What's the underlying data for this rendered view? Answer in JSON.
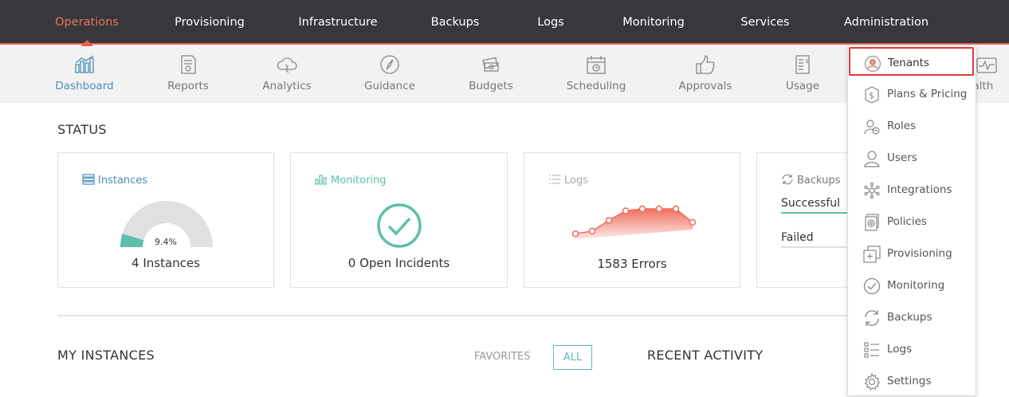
{
  "topnav": {
    "items": [
      {
        "label": "Operations",
        "active": true
      },
      {
        "label": "Provisioning"
      },
      {
        "label": "Infrastructure"
      },
      {
        "label": "Backups"
      },
      {
        "label": "Logs"
      },
      {
        "label": "Monitoring"
      },
      {
        "label": "Services"
      },
      {
        "label": "Administration"
      }
    ]
  },
  "subnav": {
    "items": [
      {
        "label": "Dashboard",
        "icon": "bar-chart-icon",
        "active": true
      },
      {
        "label": "Reports",
        "icon": "report-icon"
      },
      {
        "label": "Analytics",
        "icon": "cloud-analytics-icon"
      },
      {
        "label": "Guidance",
        "icon": "compass-icon"
      },
      {
        "label": "Budgets",
        "icon": "money-stack-icon"
      },
      {
        "label": "Scheduling",
        "icon": "calendar-clock-icon"
      },
      {
        "label": "Approvals",
        "icon": "thumbs-up-icon"
      },
      {
        "label": "Usage",
        "icon": "usage-icon"
      }
    ],
    "health_partial": "Health"
  },
  "status": {
    "title": "STATUS",
    "instances": {
      "title": "Instances",
      "gauge_label": "9.4%",
      "gauge_fraction": 0.094,
      "value": "4 Instances"
    },
    "monitoring": {
      "title": "Monitoring",
      "value": "0 Open Incidents"
    },
    "logs": {
      "title": "Logs",
      "value": "1583 Errors",
      "sparkline": [
        8,
        12,
        28,
        42,
        45,
        45,
        45,
        25
      ]
    },
    "backups": {
      "title": "Backups",
      "successful": "Successful",
      "failed": "Failed"
    }
  },
  "bottom": {
    "my_instances": "MY INSTANCES",
    "favorites": "FAVORITES",
    "all": "ALL",
    "recent_activity": "RECENT ACTIVITY"
  },
  "dropdown": {
    "items": [
      {
        "label": "Tenants",
        "icon": "tenant-icon",
        "selected": true
      },
      {
        "label": "Plans & Pricing",
        "icon": "dollar-icon"
      },
      {
        "label": "Roles",
        "icon": "roles-icon"
      },
      {
        "label": "Users",
        "icon": "user-icon"
      },
      {
        "label": "Integrations",
        "icon": "integrations-icon"
      },
      {
        "label": "Policies",
        "icon": "policies-icon"
      },
      {
        "label": "Provisioning",
        "icon": "provisioning-icon"
      },
      {
        "label": "Monitoring",
        "icon": "check-circle-icon"
      },
      {
        "label": "Backups",
        "icon": "refresh-icon"
      },
      {
        "label": "Logs",
        "icon": "list-icon"
      },
      {
        "label": "Settings",
        "icon": "gear-icon"
      }
    ]
  },
  "colors": {
    "accent": "#e8604c",
    "nav_bg": "#36383c",
    "teal": "#5cc0a8",
    "blue": "#4a90b8",
    "selection": "#e0383a"
  }
}
